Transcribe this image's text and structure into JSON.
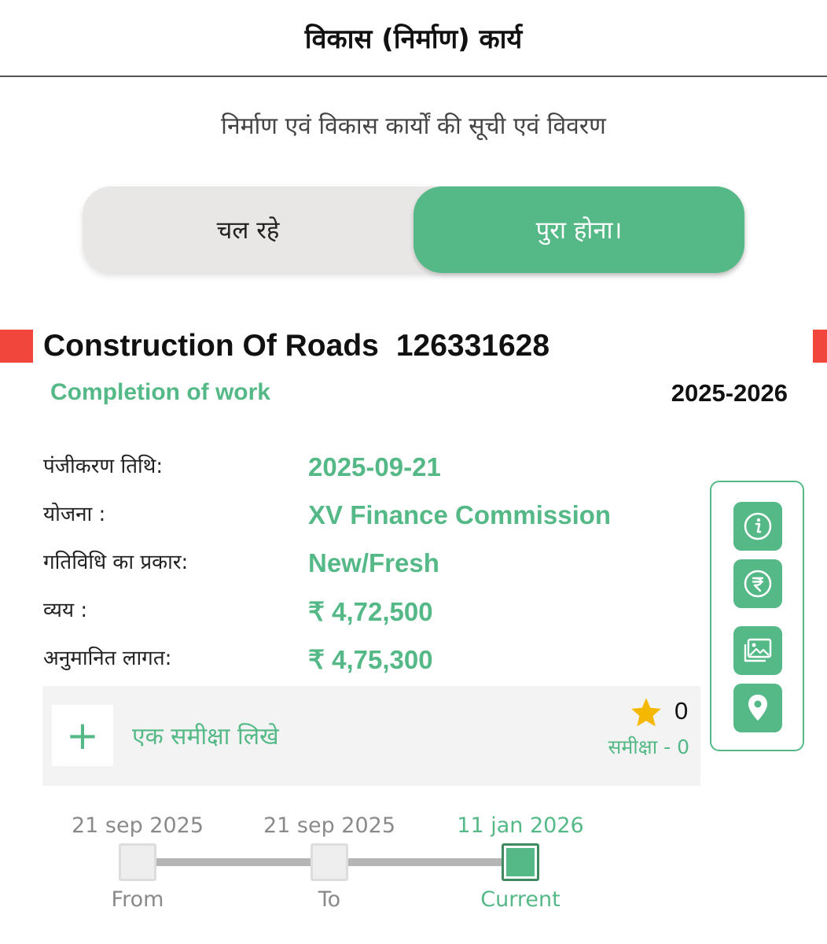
{
  "header": {
    "title": "विकास (निर्माण) कार्य"
  },
  "subtitle": "निर्माण एवं विकास कार्यों की सूची एवं विवरण",
  "tabs": [
    {
      "label": "चल रहे",
      "active": false
    },
    {
      "label": "पुरा होना।",
      "active": true
    }
  ],
  "work": {
    "name": "Construction Of Roads",
    "id": "126331628",
    "status": "Completion of work",
    "year": "2025-2026",
    "details": [
      {
        "label": "पंजीकरण तिथि:",
        "value": "2025-09-21"
      },
      {
        "label": "योजना :",
        "value": "XV Finance Commission"
      },
      {
        "label": "गतिविधि का प्रकार:",
        "value": "New/Fresh"
      },
      {
        "label": "व्यय :",
        "value": "₹ 4,72,500"
      },
      {
        "label": "अनुमानित लागत:",
        "value": "₹ 4,75,300"
      }
    ]
  },
  "actions": [
    {
      "icon": "info-icon"
    },
    {
      "icon": "rupee-icon"
    },
    {
      "icon": "gallery-icon"
    },
    {
      "icon": "location-pin-icon"
    }
  ],
  "review": {
    "add_icon": "+",
    "add_label": "एक समीक्षा लिखे",
    "rating": "0",
    "count_label": "समीक्षा - 0",
    "star_color": "#f5b800"
  },
  "timeline": [
    {
      "date": "21 sep 2025",
      "label": "From",
      "current": false
    },
    {
      "date": "21 sep 2025",
      "label": "To",
      "current": false
    },
    {
      "date": "11 jan 2026",
      "label": "Current",
      "current": true
    }
  ],
  "colors": {
    "accent": "#55b987",
    "marker": "#f0463c",
    "tab_bg": "#e9e7e6"
  }
}
